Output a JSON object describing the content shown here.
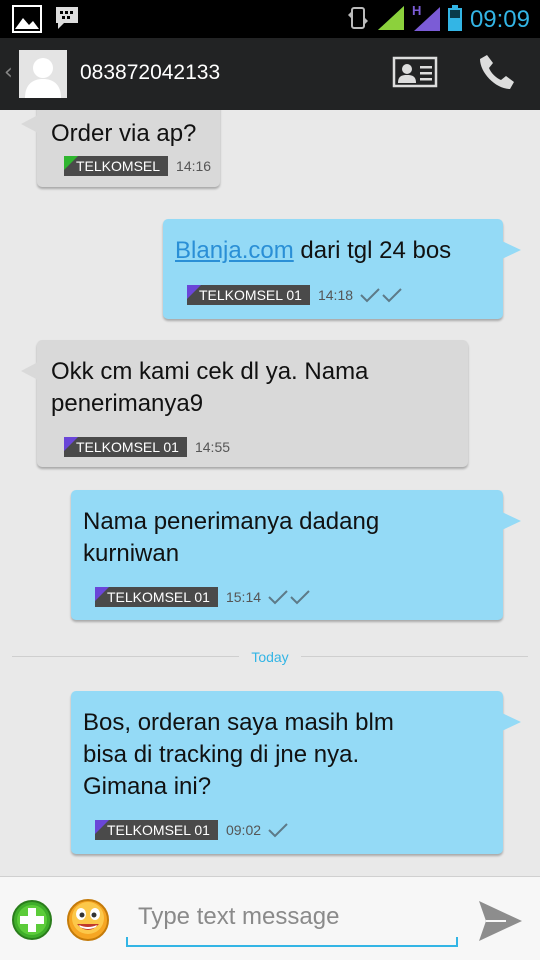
{
  "status_bar": {
    "time": "09:09",
    "network_indicator": "H"
  },
  "action_bar": {
    "contact": "083872042133"
  },
  "messages": [
    {
      "direction": "incoming",
      "text": "Order via ap?",
      "sim": "TELKOMSEL",
      "time": "14:16",
      "sim_color": "#2fb62f"
    },
    {
      "direction": "outgoing",
      "link": "Blanja.com",
      "text": " dari tgl 24 bos",
      "sim": "TELKOMSEL 01",
      "time": "14:18",
      "ticks": 2
    },
    {
      "direction": "incoming",
      "line1": "Okk cm kami cek dl ya. Nama",
      "line2": "penerimanya9",
      "sim": "TELKOMSEL 01",
      "time": "14:55"
    },
    {
      "direction": "outgoing",
      "line1": "Nama penerimanya dadang",
      "line2": "kurniwan",
      "sim": "TELKOMSEL 01",
      "time": "15:14",
      "ticks": 2
    },
    {
      "direction": "outgoing",
      "line1": "Bos, orderan saya masih blm",
      "line2": "bisa di tracking di jne nya.",
      "line3": "Gimana ini?",
      "sim": "TELKOMSEL 01",
      "time": "09:02",
      "ticks": 1
    }
  ],
  "divider": {
    "label": "Today"
  },
  "compose": {
    "placeholder": "Type text message"
  },
  "colors": {
    "accent": "#33b5e5",
    "outgoing_bubble": "#94daf6",
    "incoming_bubble": "#d9d9d9",
    "sim_flag": "#6a46d8"
  },
  "icons": [
    "image-icon",
    "bbm-icon",
    "sync-icon",
    "signal-icon",
    "battery-icon",
    "contact-card-icon",
    "phone-icon",
    "add-icon",
    "smiley-icon",
    "send-icon"
  ]
}
